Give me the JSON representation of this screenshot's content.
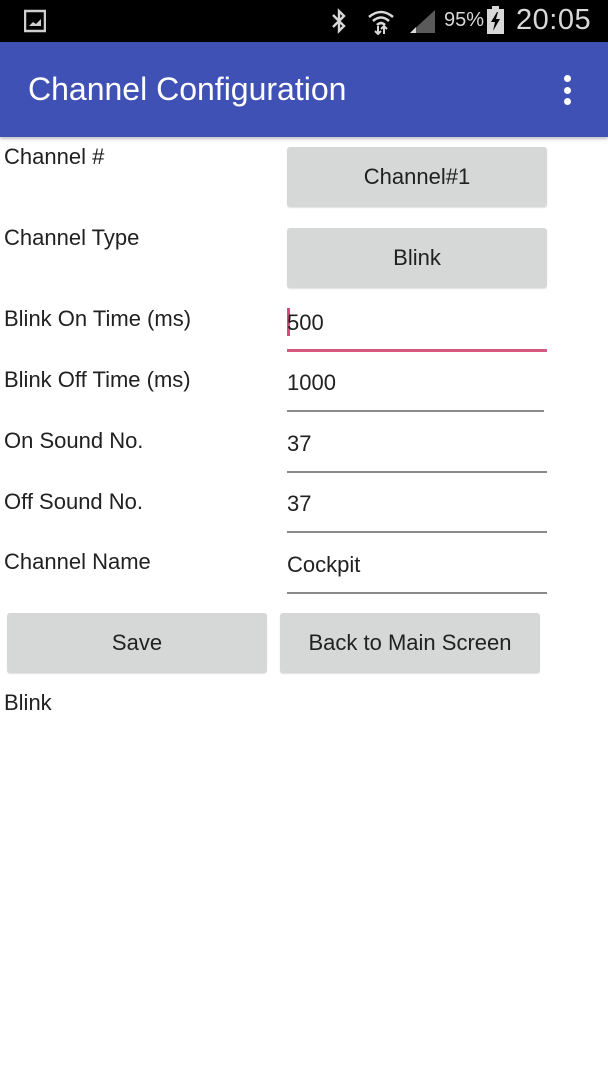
{
  "status_bar": {
    "notification_icon": "gallery-icon",
    "bluetooth_icon": "bluetooth-icon",
    "wifi_icon": "wifi-icon",
    "signal_icon": "cell-signal-icon",
    "battery_percent": "95%",
    "battery_icon": "battery-charging-icon",
    "time": "20:05"
  },
  "app_bar": {
    "title": "Channel Configuration",
    "menu_icon": "overflow-menu-icon",
    "color": "#3f51b5"
  },
  "form": {
    "channel_number": {
      "label": "Channel #",
      "value": "Channel#1"
    },
    "channel_type": {
      "label": "Channel Type",
      "value": "Blink"
    },
    "blink_on_time": {
      "label": "Blink On Time (ms)",
      "value": "500"
    },
    "blink_off_time": {
      "label": "Blink Off Time (ms)",
      "value": "1000"
    },
    "on_sound": {
      "label": "On Sound No.",
      "value": "37"
    },
    "off_sound": {
      "label": "Off Sound No.",
      "value": "37"
    },
    "channel_name": {
      "label": "Channel Name",
      "value": "Cockpit"
    }
  },
  "actions": {
    "save_label": "Save",
    "back_label": "Back to Main Screen"
  },
  "status_text": "Blink",
  "colors": {
    "accent": "#e0457b",
    "button_bg": "#d6d7d7"
  }
}
